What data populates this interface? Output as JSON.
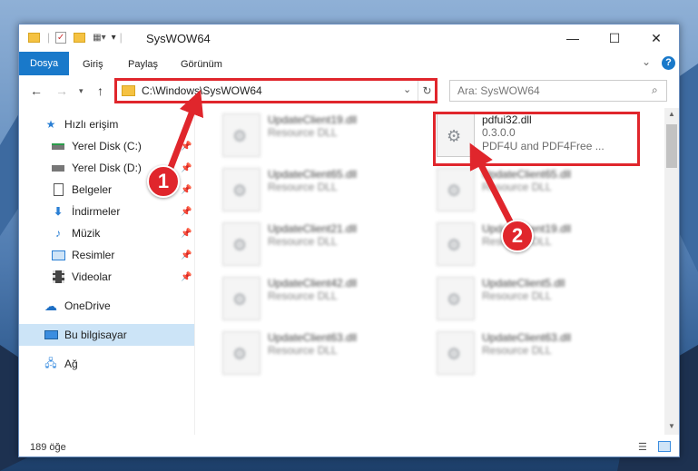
{
  "window": {
    "title": "SysWOW64",
    "controls": {
      "minimize": "—",
      "maximize": "☐",
      "close": "✕"
    }
  },
  "ribbon": {
    "tabs": [
      "Dosya",
      "Giriş",
      "Paylaş",
      "Görünüm"
    ],
    "help": "?",
    "collapse": "⌄"
  },
  "nav": {
    "address": "C:\\Windows\\SysWOW64",
    "search_placeholder": "Ara: SysWOW64"
  },
  "sidebar": {
    "items": [
      {
        "label": "Hızlı erişim",
        "icon": "star-icon"
      },
      {
        "label": "Yerel Disk (C:)",
        "icon": "drive-icon"
      },
      {
        "label": "Yerel Disk (D:)",
        "icon": "drive-icon"
      },
      {
        "label": "Belgeler",
        "icon": "documents-icon"
      },
      {
        "label": "İndirmeler",
        "icon": "download-icon"
      },
      {
        "label": "Müzik",
        "icon": "music-icon"
      },
      {
        "label": "Resimler",
        "icon": "pictures-icon"
      },
      {
        "label": "Videolar",
        "icon": "video-icon"
      },
      {
        "label": "OneDrive",
        "icon": "cloud-icon"
      },
      {
        "label": "Bu bilgisayar",
        "icon": "computer-icon"
      },
      {
        "label": "Ağ",
        "icon": "network-icon"
      }
    ]
  },
  "files": {
    "highlighted": {
      "name": "pdfui32.dll",
      "version": "0.3.0.0",
      "desc": "PDF4U and PDF4Free ..."
    },
    "left": [
      {
        "name": "UpdateClient19.dll",
        "type": "Resource DLL"
      },
      {
        "name": "UpdateClient65.dll",
        "type": "Resource DLL"
      },
      {
        "name": "UpdateClient21.dll",
        "type": "Resource DLL"
      },
      {
        "name": "UpdateClient42.dll",
        "type": "Resource DLL"
      },
      {
        "name": "UpdateClient63.dll",
        "type": "Resource DLL"
      }
    ],
    "right": [
      {
        "name": "UpdateClient65.dll",
        "type": "Resource DLL"
      },
      {
        "name": "UpdateClient19.dll",
        "type": "Resource DLL"
      },
      {
        "name": "UpdateClient5.dll",
        "type": "Resource DLL"
      },
      {
        "name": "UpdateClient63.dll",
        "type": "Resource DLL"
      }
    ]
  },
  "status": {
    "count": "189 öğe"
  },
  "annotations": {
    "badge1": "1",
    "badge2": "2",
    "color": "#e0262c"
  }
}
